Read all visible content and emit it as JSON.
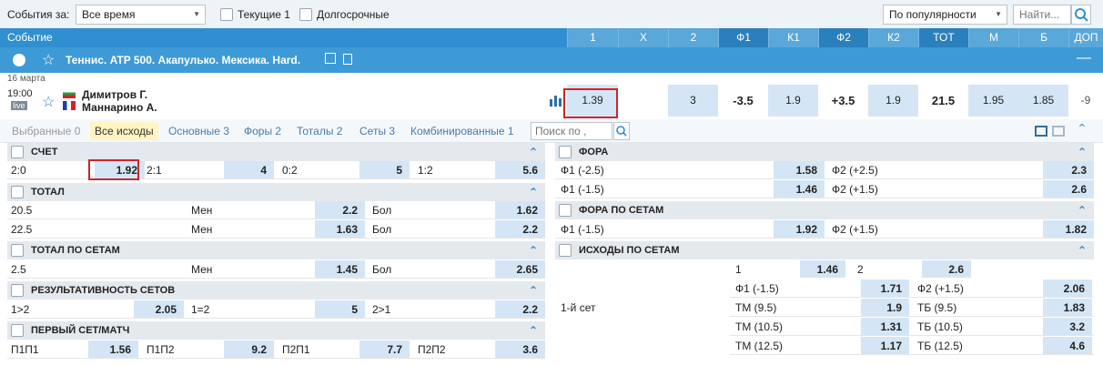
{
  "top": {
    "events_label": "События за:",
    "period": "Все время",
    "current": "Текущие 1",
    "longterm": "Долгосрочные",
    "sort": "По популярности",
    "search_placeholder": "Найти..."
  },
  "header": {
    "event": "Событие",
    "cols": [
      "1",
      "X",
      "2",
      "Ф1",
      "К1",
      "Ф2",
      "К2",
      "ТОТ",
      "М",
      "Б",
      "ДОП"
    ]
  },
  "league": {
    "title": "Теннис. ATP 500. Акапулько. Мексика. Hard."
  },
  "date": "16 марта",
  "event": {
    "time": "19:00",
    "live": "live",
    "team1": "Димитров Г.",
    "team2": "Маннарино А.",
    "odds": [
      "1.39",
      "",
      "3",
      "-3.5",
      "1.9",
      "+3.5",
      "1.9",
      "21.5",
      "1.95",
      "1.85",
      "-9"
    ]
  },
  "tabs": {
    "selected": "Выбранные 0",
    "all": "Все исходы",
    "main": "Основные 3",
    "handicaps": "Форы 2",
    "totals": "Тоталы 2",
    "sets": "Сеты 3",
    "combined": "Комбинированные 1",
    "search_placeholder": "Поиск по ,"
  },
  "left": {
    "score": {
      "title": "СЧЕТ",
      "cells": [
        "2:0",
        "1.92",
        "2:1",
        "4",
        "0:2",
        "5",
        "1:2",
        "5.6"
      ]
    },
    "total": {
      "title": "ТОТАЛ",
      "rows": [
        [
          "20.5",
          "Мен",
          "2.2",
          "Бол",
          "1.62"
        ],
        [
          "22.5",
          "Мен",
          "1.63",
          "Бол",
          "2.2"
        ]
      ]
    },
    "total_sets": {
      "title": "ТОТАЛ ПО СЕТАМ",
      "rows": [
        [
          "2.5",
          "Мен",
          "1.45",
          "Бол",
          "2.65"
        ]
      ]
    },
    "sets_result": {
      "title": "РЕЗУЛЬТАТИВНОСТЬ СЕТОВ",
      "cells": [
        "1>2",
        "2.05",
        "1=2",
        "5",
        "2>1",
        "2.2"
      ]
    },
    "first_set_match": {
      "title": "ПЕРВЫЙ СЕТ/МАТЧ",
      "cells": [
        "П1П1",
        "1.56",
        "П1П2",
        "9.2",
        "П2П1",
        "7.7",
        "П2П2",
        "3.6"
      ]
    }
  },
  "right": {
    "fora": {
      "title": "ФОРА",
      "rows": [
        [
          "Ф1 (-2.5)",
          "1.58",
          "Ф2 (+2.5)",
          "2.3"
        ],
        [
          "Ф1 (-1.5)",
          "1.46",
          "Ф2 (+1.5)",
          "2.6"
        ]
      ]
    },
    "fora_sets": {
      "title": "ФОРА ПО СЕТАМ",
      "rows": [
        [
          "Ф1 (-1.5)",
          "1.92",
          "Ф2 (+1.5)",
          "1.82"
        ]
      ]
    },
    "set_outcomes": {
      "title": "ИСХОДЫ ПО СЕТАМ",
      "set_label": "1-й сет",
      "top": [
        "1",
        "1.46",
        "2",
        "2.6"
      ],
      "rows": [
        [
          "Ф1 (-1.5)",
          "1.71",
          "Ф2 (+1.5)",
          "2.06"
        ],
        [
          "ТМ (9.5)",
          "1.9",
          "ТБ (9.5)",
          "1.83"
        ],
        [
          "ТМ (10.5)",
          "1.31",
          "ТБ (10.5)",
          "3.2"
        ],
        [
          "ТМ (12.5)",
          "1.17",
          "ТБ (12.5)",
          "4.6"
        ]
      ]
    }
  }
}
